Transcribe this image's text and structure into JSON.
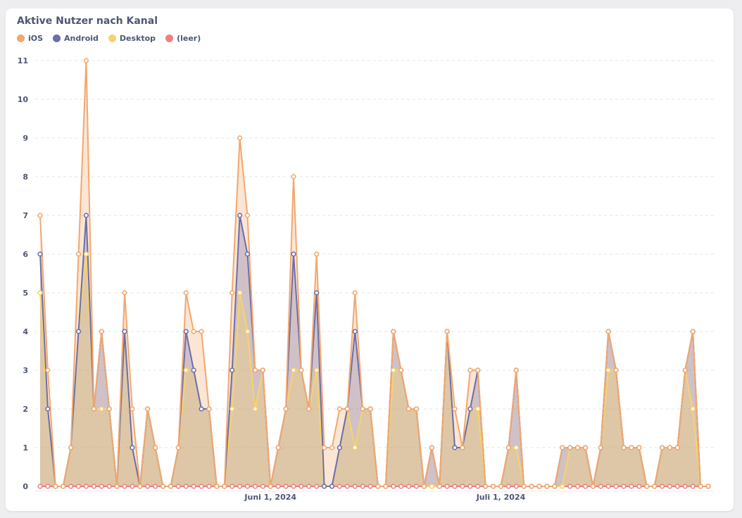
{
  "chart_title": "Aktive Nutzer nach Kanal",
  "chart_data": {
    "type": "area",
    "title": "Aktive Nutzer nach Kanal",
    "xlabel": "",
    "ylabel": "",
    "ylim": [
      0,
      11
    ],
    "yticks": [
      0,
      1,
      2,
      3,
      4,
      5,
      6,
      7,
      8,
      9,
      10,
      11
    ],
    "x_ticks": [
      {
        "index": 30,
        "label": "Juni 1, 2024"
      },
      {
        "index": 60,
        "label": "Juli 1, 2024"
      }
    ],
    "grid": true,
    "legend_position": "top-left",
    "series": [
      {
        "name": "iOS",
        "color": "#f2a86f",
        "values": [
          7,
          3,
          0,
          0,
          1,
          6,
          11,
          2,
          4,
          2,
          0,
          5,
          2,
          0,
          2,
          1,
          0,
          0,
          1,
          5,
          4,
          4,
          2,
          0,
          0,
          5,
          9,
          7,
          3,
          3,
          0,
          1,
          2,
          8,
          3,
          2,
          6,
          1,
          1,
          2,
          2,
          5,
          2,
          2,
          0,
          0,
          4,
          3,
          2,
          2,
          0,
          1,
          0,
          4,
          2,
          1,
          3,
          3,
          0,
          0,
          0,
          1,
          3,
          0,
          0,
          0,
          0,
          0,
          1,
          1,
          1,
          1,
          0,
          1,
          4,
          3,
          1,
          1,
          1,
          0,
          0,
          1,
          1,
          1,
          3,
          4,
          0,
          0
        ]
      },
      {
        "name": "Android",
        "color": "#6c6eaa",
        "values": [
          6,
          2,
          0,
          0,
          1,
          4,
          7,
          2,
          4,
          2,
          0,
          4,
          1,
          0,
          2,
          1,
          0,
          0,
          1,
          4,
          3,
          2,
          2,
          0,
          0,
          3,
          7,
          6,
          3,
          3,
          0,
          1,
          2,
          6,
          3,
          2,
          5,
          0,
          0,
          1,
          2,
          4,
          2,
          2,
          0,
          0,
          4,
          3,
          2,
          2,
          0,
          1,
          0,
          4,
          1,
          1,
          2,
          3,
          0,
          0,
          0,
          1,
          3,
          0,
          0,
          0,
          0,
          0,
          1,
          1,
          1,
          1,
          0,
          1,
          4,
          3,
          1,
          1,
          1,
          0,
          0,
          1,
          1,
          1,
          3,
          4,
          0,
          0
        ]
      },
      {
        "name": "Desktop",
        "color": "#f7d36b",
        "values": [
          5,
          2,
          0,
          0,
          1,
          4,
          6,
          2,
          2,
          2,
          0,
          4,
          1,
          0,
          2,
          1,
          0,
          0,
          1,
          3,
          3,
          2,
          2,
          0,
          0,
          2,
          5,
          4,
          2,
          3,
          0,
          1,
          2,
          3,
          3,
          2,
          3,
          0,
          0,
          1,
          2,
          1,
          2,
          2,
          0,
          0,
          3,
          3,
          2,
          2,
          0,
          0,
          0,
          4,
          1,
          1,
          2,
          2,
          0,
          0,
          0,
          1,
          1,
          0,
          0,
          0,
          0,
          0,
          0,
          1,
          1,
          1,
          0,
          1,
          3,
          3,
          1,
          1,
          1,
          0,
          0,
          1,
          1,
          1,
          3,
          2,
          0,
          0
        ]
      },
      {
        "name": "(leer)",
        "color": "#ed8181",
        "values": [
          0,
          0,
          0,
          0,
          0,
          0,
          0,
          0,
          0,
          0,
          0,
          0,
          0,
          0,
          0,
          0,
          0,
          0,
          0,
          0,
          0,
          0,
          0,
          0,
          0,
          0,
          0,
          0,
          0,
          0,
          0,
          0,
          0,
          0,
          0,
          0,
          0,
          0,
          0,
          0,
          0,
          0,
          0,
          0,
          0,
          0,
          0,
          0,
          0,
          0,
          0,
          0,
          0,
          0,
          0,
          0,
          0,
          0,
          0,
          0,
          0,
          0,
          0,
          0,
          0,
          0,
          0,
          0,
          0,
          0,
          0,
          0,
          0,
          0,
          0,
          0,
          0,
          0,
          0,
          0,
          0,
          0,
          0,
          0,
          0,
          0,
          0,
          0
        ]
      }
    ]
  }
}
